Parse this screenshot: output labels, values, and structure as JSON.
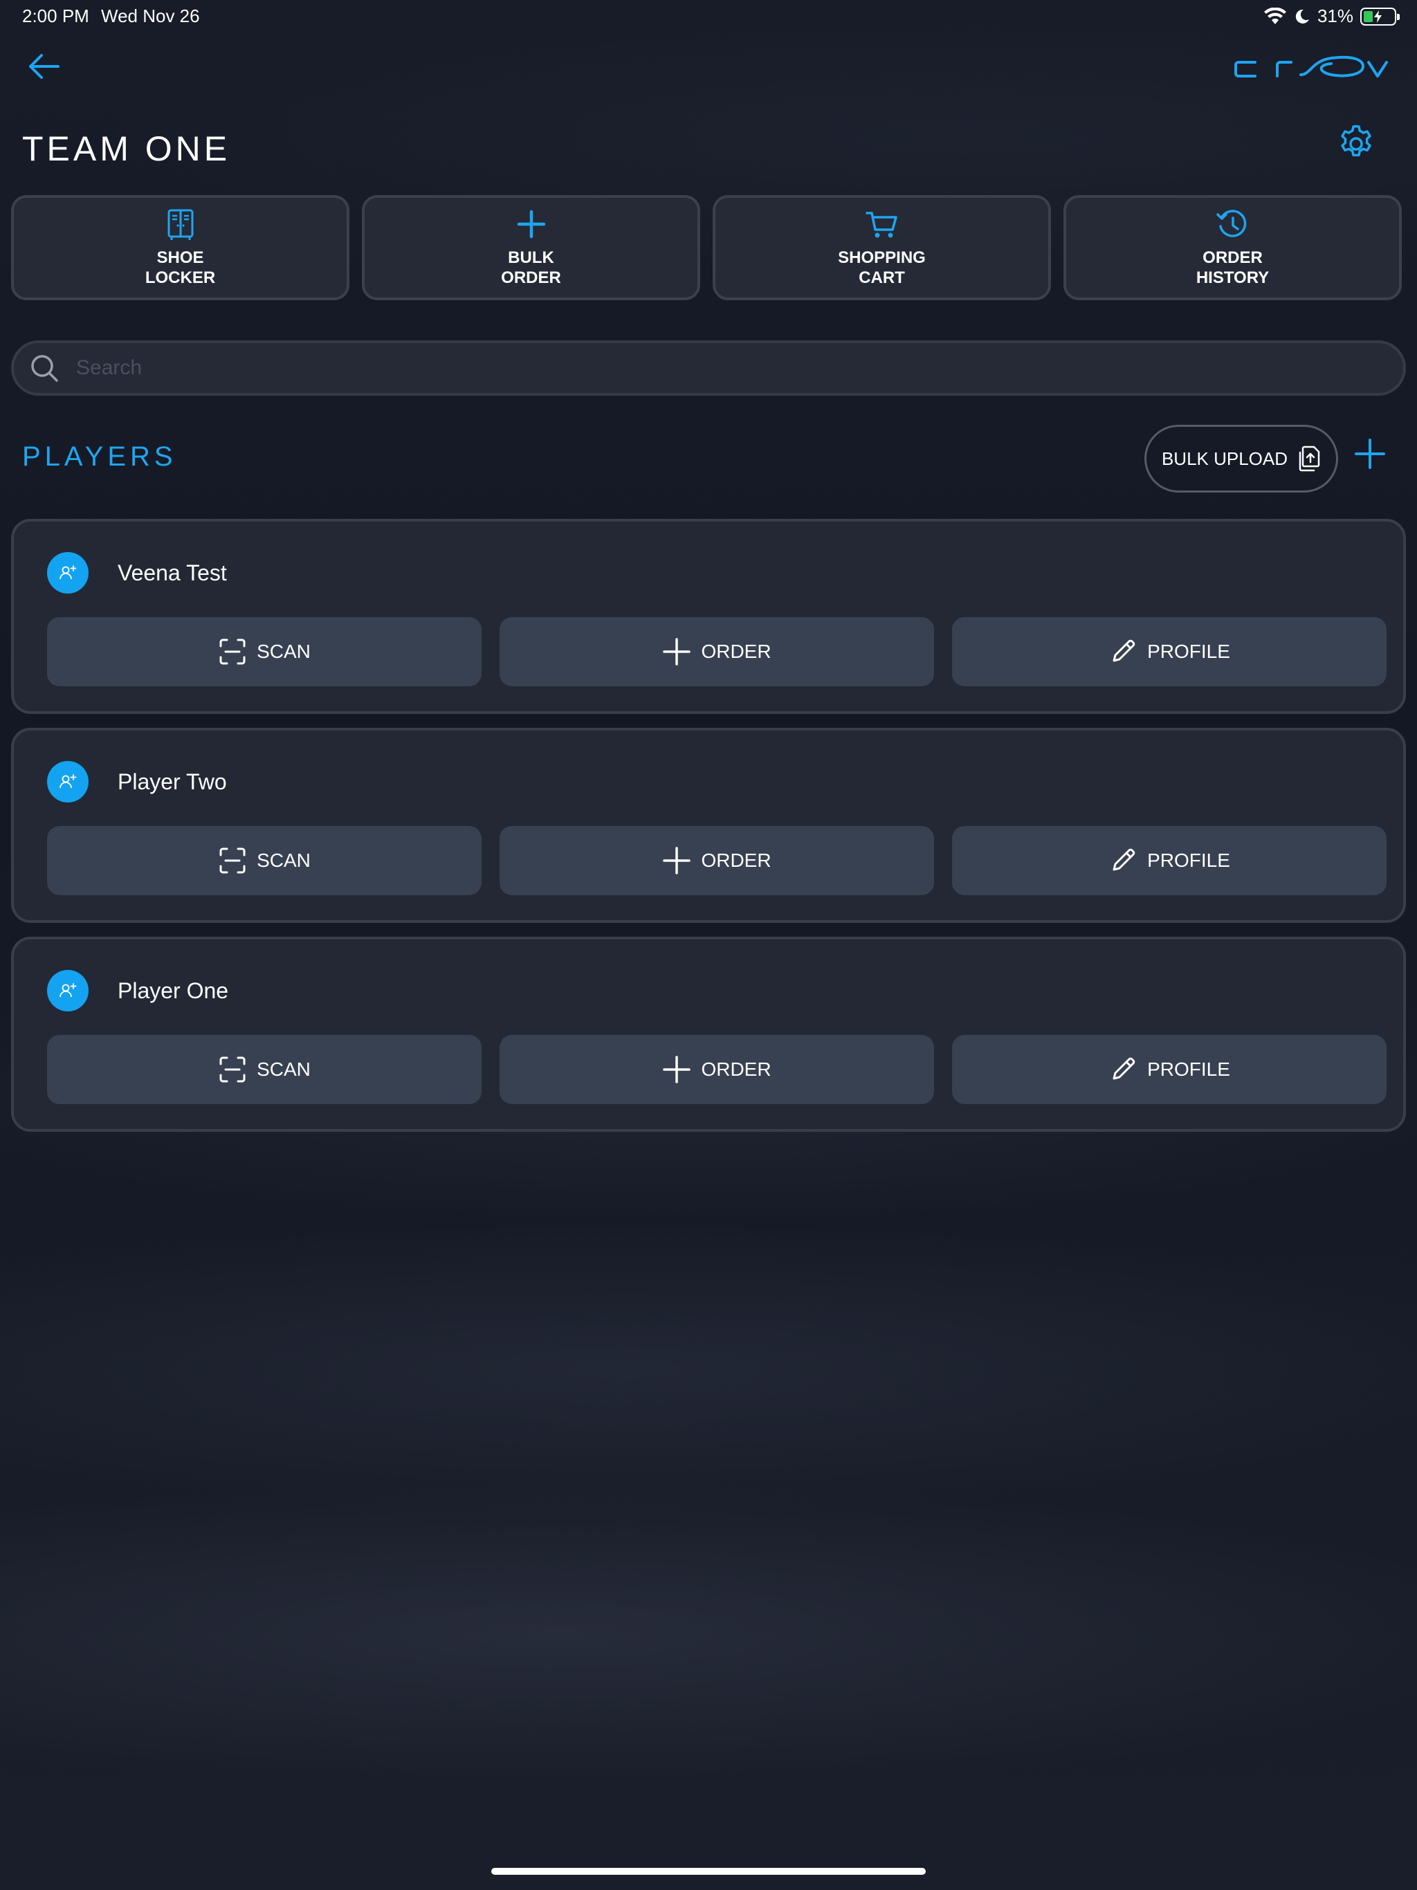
{
  "status": {
    "time": "2:00 PM",
    "date": "Wed Nov 26",
    "battery": "31%"
  },
  "header": {
    "title": "TEAM ONE",
    "logo": "grov-logo"
  },
  "quick_actions": [
    {
      "label": "SHOE\nLOCKER",
      "icon": "locker-icon"
    },
    {
      "label": "BULK\nORDER",
      "icon": "plus-icon"
    },
    {
      "label": "SHOPPING\nCART",
      "icon": "cart-icon"
    },
    {
      "label": "ORDER\nHISTORY",
      "icon": "history-icon"
    }
  ],
  "search": {
    "placeholder": "Search",
    "value": ""
  },
  "players_section": {
    "title": "PLAYERS",
    "bulk_upload_label": "BULK UPLOAD"
  },
  "players": [
    {
      "name": "Veena Test"
    },
    {
      "name": "Player Two"
    },
    {
      "name": "Player One"
    }
  ],
  "player_actions": {
    "scan": "SCAN",
    "order": "ORDER",
    "profile": "PROFILE"
  },
  "colors": {
    "accent": "#1ea5f0",
    "background": "#171b26",
    "card": "#232834",
    "button": "#384151"
  }
}
